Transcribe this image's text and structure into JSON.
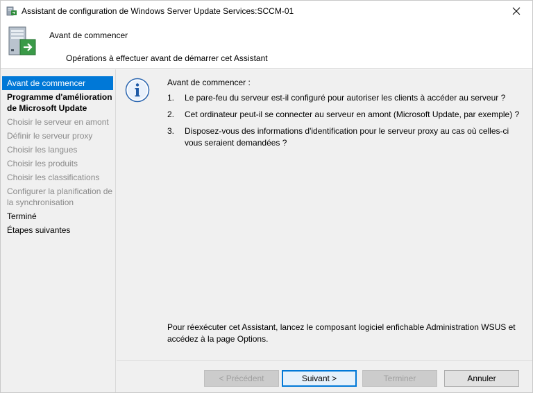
{
  "window": {
    "title": "Assistant de configuration de Windows Server Update Services:SCCM-01",
    "close_icon": "close-icon"
  },
  "header": {
    "title": "Avant de commencer",
    "subtitle": "Opérations à effectuer avant de démarrer cet Assistant",
    "icon": "server-update-icon"
  },
  "sidebar": {
    "items": [
      {
        "label": "Avant de commencer",
        "state": "active"
      },
      {
        "label": "Programme d'amélioration de Microsoft Update",
        "state": "completed"
      },
      {
        "label": "Choisir le serveur en amont",
        "state": "disabled"
      },
      {
        "label": "Définir le serveur proxy",
        "state": "disabled"
      },
      {
        "label": "Choisir les langues",
        "state": "disabled"
      },
      {
        "label": "Choisir les produits",
        "state": "disabled"
      },
      {
        "label": "Choisir les classifications",
        "state": "disabled"
      },
      {
        "label": "Configurer la planification de la synchronisation",
        "state": "disabled"
      },
      {
        "label": "Terminé",
        "state": "plain"
      },
      {
        "label": "Étapes suivantes",
        "state": "plain"
      }
    ]
  },
  "main": {
    "info_icon": "info-icon",
    "intro": "Avant de commencer :",
    "steps": [
      {
        "num": "1.",
        "text": "Le pare-feu du serveur est-il configuré pour autoriser les clients à accéder au serveur ?"
      },
      {
        "num": "2.",
        "text": "Cet ordinateur peut-il se connecter au serveur en amont (Microsoft Update, par exemple) ?"
      },
      {
        "num": "3.",
        "text": "Disposez-vous des informations d'identification pour le serveur proxy au cas où celles-ci vous seraient demandées ?"
      }
    ],
    "footer_note": "Pour réexécuter cet Assistant, lancez le composant logiciel enfichable Administration WSUS et accédez à la page Options."
  },
  "buttons": {
    "previous": "< Précédent",
    "next": "Suivant >",
    "finish": "Terminer",
    "cancel": "Annuler"
  },
  "colors": {
    "accent": "#0078d7",
    "panel_bg": "#f0f0f0",
    "disabled_text": "#8a8a8a"
  }
}
